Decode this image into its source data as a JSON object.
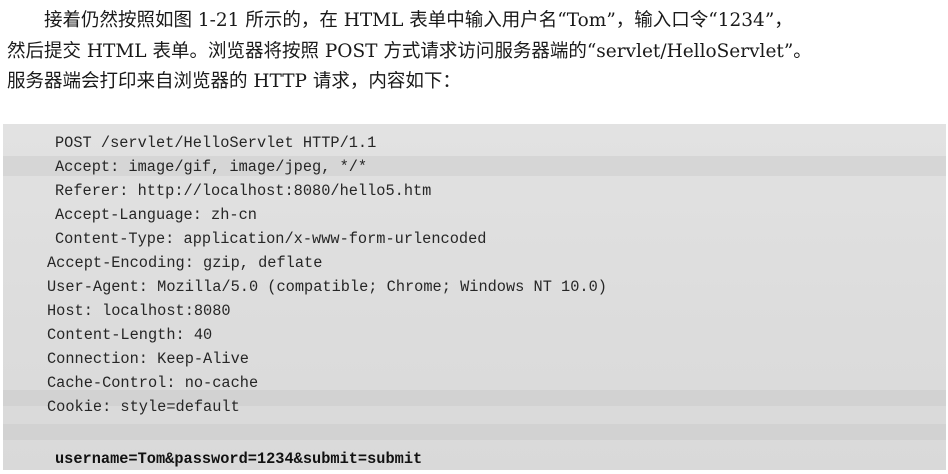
{
  "paragraph": {
    "line1": "接着仍然按照如图 1-21 所示的，在 HTML 表单中输入用户名“Tom”，输入口令“1234”，",
    "line2": "然后提交 HTML 表单。浏览器将按照 POST 方式请求访问服务器端的“servlet/HelloServlet”。",
    "line3": "服务器端会打印来自浏览器的 HTTP 请求，内容如下："
  },
  "http_request": {
    "request_line": "POST /servlet/HelloServlet HTTP/1.1",
    "headers": [
      "Accept: image/gif, image/jpeg, */*",
      "Referer: http://localhost:8080/hello5.htm",
      "Accept-Language: zh-cn",
      "Content-Type: application/x-www-form-urlencoded",
      "Accept-Encoding: gzip, deflate",
      "User-Agent: Mozilla/5.0 (compatible; Chrome; Windows NT 10.0)",
      "Host: localhost:8080",
      "Content-Length: 40",
      "Connection: Keep-Alive",
      "Cache-Control: no-cache",
      "Cookie: style=default"
    ],
    "body": "username=Tom&password=1234&submit=submit"
  }
}
